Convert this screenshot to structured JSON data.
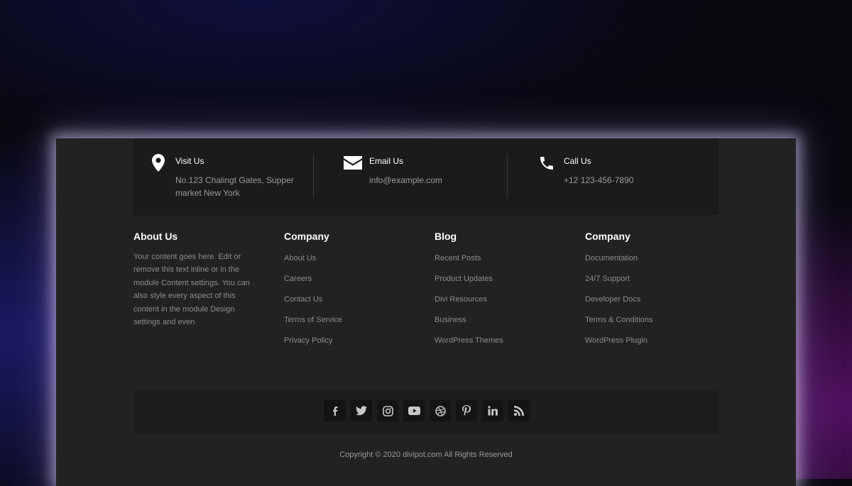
{
  "contact": {
    "visit": {
      "title": "Visit Us",
      "line1": "No.123 Chalingt Gates, Supper",
      "line2": "market New York",
      "icon": "map-pin-icon"
    },
    "email": {
      "title": "Email Us",
      "text": "info@example.com",
      "icon": "envelope-icon"
    },
    "call": {
      "title": "Call Us",
      "text": "+12 123-456-7890",
      "icon": "phone-icon"
    }
  },
  "about": {
    "title": "About Us",
    "text": "Your content goes here. Edit or remove this text inline or in the module Content settings. You can also style every aspect of this content in the module Design settings and even"
  },
  "columns": [
    {
      "title": "Company",
      "links": [
        "About Us",
        "Careers",
        "Contact Us",
        "Terms of Service",
        "Privacy Policy"
      ]
    },
    {
      "title": "Blog",
      "links": [
        "Recent Posts",
        "Product Updates",
        "Divi Resources",
        "Business",
        "WordPress Themes"
      ]
    },
    {
      "title": "Company",
      "links": [
        "Documentation",
        "24/7 Support",
        "Developer Docs",
        "Terms & Conditions",
        "WordPress Plugin"
      ]
    }
  ],
  "social": [
    "facebook-icon",
    "twitter-icon",
    "instagram-icon",
    "youtube-icon",
    "dribbble-icon",
    "pinterest-icon",
    "linkedin-icon",
    "rss-icon"
  ],
  "copyright": "Copyright © 2020 divipot.com All Rights Reserved",
  "colors": {
    "panel": "#222222",
    "contact_bar": "#1b1b1b",
    "heading": "#ffffff",
    "text": "#8c8c8c"
  }
}
